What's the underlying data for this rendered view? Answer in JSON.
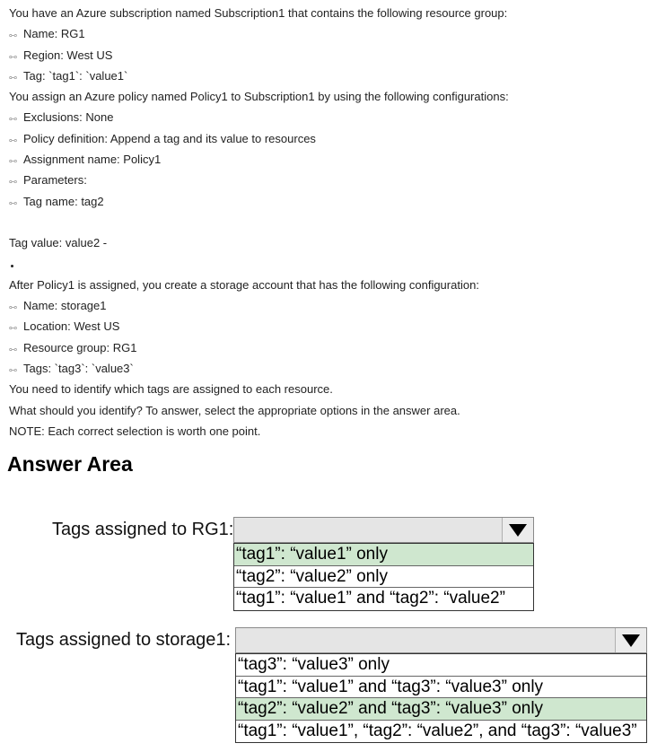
{
  "question": {
    "intro": "You have an Azure subscription named Subscription1 that contains the following resource group:",
    "rg_bullets": [
      "Name: RG1",
      "Region: West US",
      "Tag: `tag1`: `value1`"
    ],
    "assign_intro": "You assign an Azure policy named Policy1 to Subscription1 by using the following configurations:",
    "policy_bullets": [
      "Exclusions: None",
      "Policy definition: Append a tag and its value to resources",
      "Assignment name: Policy1",
      "Parameters:",
      "Tag name: tag2"
    ],
    "tag_value": "Tag value: value2 -",
    "after_intro": "After Policy1 is assigned, you create a storage account that has the following configuration:",
    "storage_bullets": [
      "Name: storage1",
      "Location: West US",
      "Resource group: RG1",
      "Tags: `tag3`: `value3`"
    ],
    "identify": "You need to identify which tags are assigned to each resource.",
    "what": "What should you identify? To answer, select the appropriate options in the answer area.",
    "note": "NOTE: Each correct selection is worth one point.",
    "bullet_glyph": "⧟"
  },
  "answer_area": {
    "title": "Answer Area",
    "rows": [
      {
        "label": "Tags assigned to RG1:",
        "options": [
          "“tag1”: “value1” only",
          "“tag2”: “value2” only",
          "“tag1”: “value1” and “tag2”: “value2”"
        ],
        "selected_index": 0
      },
      {
        "label": "Tags assigned to storage1:",
        "options": [
          "“tag3”: “value3” only",
          "“tag1”: “value1” and “tag3”: “value3” only",
          "“tag2”: “value2” and “tag3”: “value3” only",
          "“tag1”: “value1”, “tag2”: “value2”, and “tag3”: “value3”"
        ],
        "selected_index": 2
      }
    ],
    "colors": {
      "selected": "#cfe7cf",
      "dropdown_bg": "#e5e5e5"
    },
    "arrow_icon": "triangle-down-icon"
  }
}
